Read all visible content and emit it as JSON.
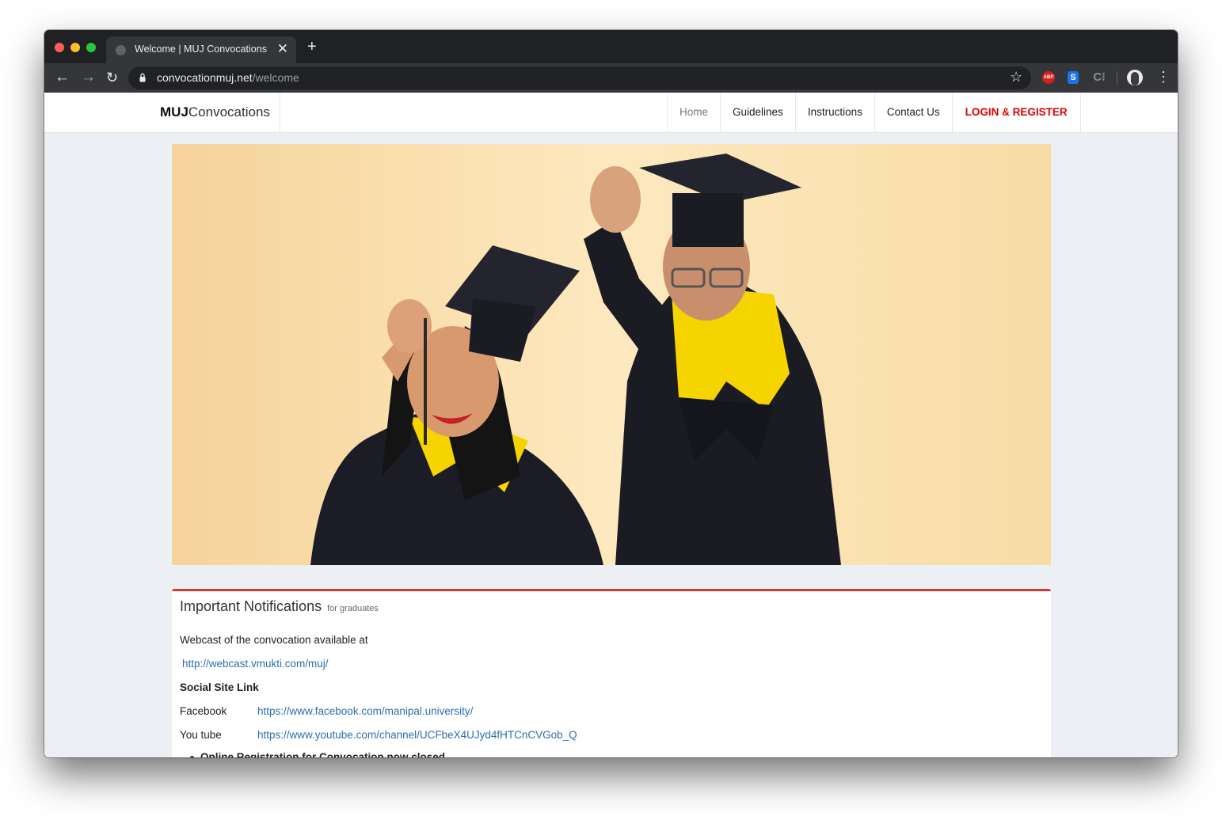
{
  "browser": {
    "tab_title": "Welcome | MUJ Convocations",
    "close_glyph": "✕",
    "new_tab_glyph": "+",
    "url_host": "convocationmuj.net",
    "url_path": "/welcome",
    "back_glyph": "←",
    "forward_glyph": "→",
    "reload_glyph": "↻",
    "star_glyph": "☆",
    "menu_glyph": "⋮",
    "extensions": {
      "abp": "ABP",
      "s": "S",
      "c": "C⁝"
    }
  },
  "navbar": {
    "brand_bold": "MUJ",
    "brand_rest": "Convocations",
    "links": [
      "Home",
      "Guidelines",
      "Instructions",
      "Contact Us",
      "LOGIN & REGISTER"
    ]
  },
  "colors": {
    "accent_red": "#d33b3b",
    "login_red": "#dd0000",
    "link_blue": "#2a6fb0",
    "page_bg": "#ecf0f5"
  },
  "notifications": {
    "title": "Important Notifications",
    "subtitle": "for graduates",
    "webcast_text": "Webcast of the convocation available at",
    "webcast_link": "http://webcast.vmukti.com/muj/",
    "social_heading": "Social Site Link",
    "social": [
      {
        "label": "Facebook",
        "url": "https://www.facebook.com/manipal.university/"
      },
      {
        "label": "You tube",
        "url": "https://www.youtube.com/channel/UCFbeX4UJyd4fHTCnCVGob_Q"
      }
    ],
    "bullet": "Online Registration for Convocation now closed"
  }
}
